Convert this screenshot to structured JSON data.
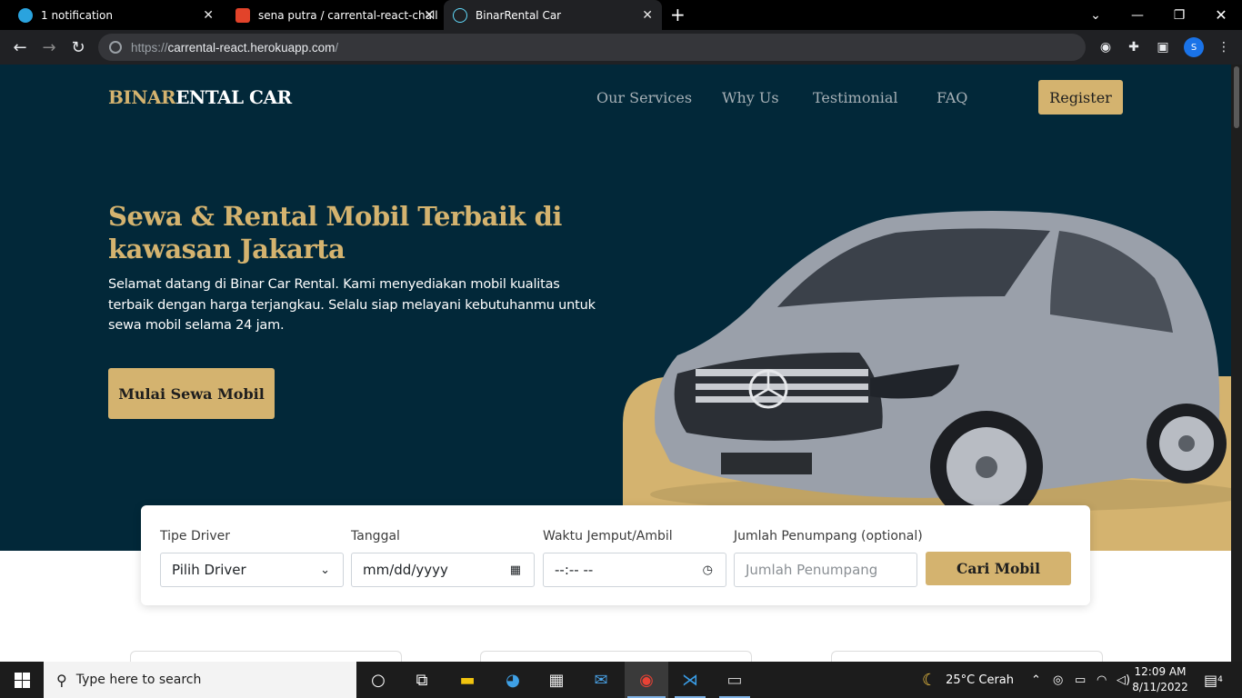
{
  "browser": {
    "tabs": [
      {
        "label": "1 notification",
        "icon": "telegram-icon",
        "active": false
      },
      {
        "label": "sena putra / carrental-react-chall",
        "icon": "gitlab-icon",
        "active": false
      },
      {
        "label": "BinarRental Car",
        "icon": "react-icon",
        "active": true
      }
    ],
    "url_prefix": "https://",
    "url_host": "carrental-react.herokuapp.com",
    "url_path": "/",
    "profile_initial": "S"
  },
  "site": {
    "brand_part1": "BINAR",
    "brand_part2": "ENTAL CAR",
    "nav": [
      "Our Services",
      "Why Us",
      "Testimonial",
      "FAQ"
    ],
    "register_label": "Register",
    "hero_title": "Sewa & Rental Mobil Terbaik di kawasan Jakarta",
    "hero_text": "Selamat datang di Binar Car Rental. Kami menyediakan mobil kualitas terbaik dengan harga terjangkau. Selalu siap melayani kebutuhanmu untuk sewa mobil selama 24 jam.",
    "cta_label": "Mulai Sewa Mobil",
    "colors": {
      "primary_dark": "#022839",
      "accent_gold": "#d4b36f"
    }
  },
  "search_form": {
    "driver_label": "Tipe Driver",
    "driver_value": "Pilih Driver",
    "date_label": "Tanggal",
    "date_value": "mm/dd/yyyy",
    "time_label": "Waktu Jemput/Ambil",
    "time_value": "--:-- --",
    "passenger_label": "Jumlah Penumpang (optional)",
    "passenger_placeholder": "Jumlah Penumpang",
    "submit_label": "Cari Mobil"
  },
  "taskbar": {
    "search_placeholder": "Type here to search",
    "weather": "25°C  Cerah",
    "time": "12:09 AM",
    "date": "8/11/2022",
    "notification_count": "4"
  }
}
